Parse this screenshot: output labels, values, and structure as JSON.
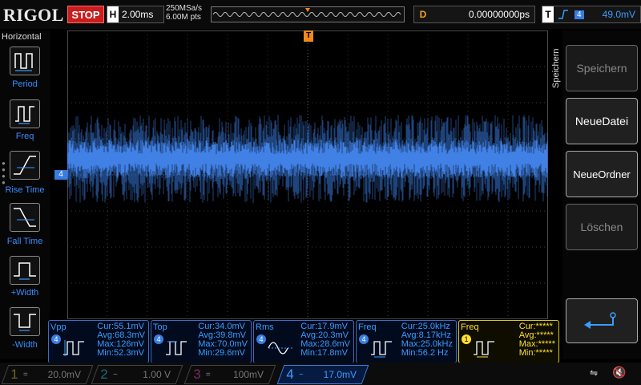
{
  "brand": "RIGOL",
  "run_state": "STOP",
  "horizontal": {
    "label": "H",
    "timebase": "2.00ms",
    "sample_rate": "250MSa/s",
    "memory_depth": "6.00M pts"
  },
  "delay": {
    "label": "D",
    "value": "0.00000000ps"
  },
  "trigger": {
    "label": "T",
    "edge": "rising-edge-icon",
    "source": "4",
    "level": "49.0mV"
  },
  "left_menu": {
    "title": "Horizontal",
    "items": [
      {
        "label": "Period",
        "icon": "period-icon"
      },
      {
        "label": "Freq",
        "icon": "freq-icon"
      },
      {
        "label": "Rise Time",
        "icon": "rise-time-icon"
      },
      {
        "label": "Fall Time",
        "icon": "fall-time-icon"
      },
      {
        "label": "+Width",
        "icon": "pos-width-icon"
      },
      {
        "label": "-Width",
        "icon": "neg-width-icon"
      }
    ]
  },
  "right_menu": {
    "title": "Speichern",
    "buttons": [
      {
        "label": "Speichern",
        "enabled": false
      },
      {
        "label": "NeueDatei",
        "enabled": true
      },
      {
        "label": "NeueOrdner",
        "enabled": true
      },
      {
        "label": "Löschen",
        "enabled": false
      }
    ],
    "back_icon": "return-arrow-icon"
  },
  "channel_marker": "4",
  "trigger_marker": "T",
  "measurements": [
    {
      "name": "Vpp",
      "source": "4",
      "cur": "Cur:55.1mV",
      "avg": "Avg:68.3mV",
      "max": "Max:126mV",
      "min": "Min:52.3mV"
    },
    {
      "name": "Top",
      "source": "4",
      "cur": "Cur:34.0mV",
      "avg": "Avg:39.8mV",
      "max": "Max:70.0mV",
      "min": "Min:29.6mV"
    },
    {
      "name": "Rms",
      "source": "4",
      "cur": "Cur:17.9mV",
      "avg": "Avg:20.3mV",
      "max": "Max:28.6mV",
      "min": "Min:17.8mV"
    },
    {
      "name": "Freq",
      "source": "4",
      "cur": "Cur:25.0kHz",
      "avg": "Avg:8.17kHz",
      "max": "Max:25.0kHz",
      "min": "Min:56.2 Hz"
    },
    {
      "name": "Freq",
      "source": "1",
      "cur": "Cur:*****",
      "avg": "Avg:*****",
      "max": "Max:*****",
      "min": "Min:*****"
    }
  ],
  "channels": [
    {
      "num": "1",
      "coupling": "=",
      "scale": "20.0mV",
      "color": "#d8c820"
    },
    {
      "num": "2",
      "coupling": "~",
      "scale": "1.00 V",
      "color": "#30c8e8"
    },
    {
      "num": "3",
      "coupling": "=",
      "scale": "100mV",
      "color": "#e040b0"
    },
    {
      "num": "4",
      "coupling": "~",
      "scale": "17.0mV",
      "color": "#3a7de0"
    }
  ],
  "colors": {
    "ch4": "#3a7de0",
    "trigger": "#f08a1a",
    "stop": "#c81e1e"
  }
}
